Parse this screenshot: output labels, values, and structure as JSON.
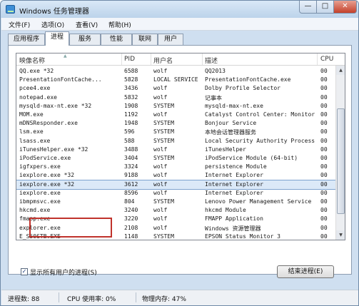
{
  "window": {
    "title": "Windows 任务管理器",
    "controls": {
      "minimize": "—",
      "maximize": "□",
      "close": "✕"
    }
  },
  "menu": [
    "文件(F)",
    "选项(O)",
    "查看(V)",
    "帮助(H)"
  ],
  "tabs": [
    {
      "label": "应用程序",
      "active": false
    },
    {
      "label": "进程",
      "active": true
    },
    {
      "label": "服务",
      "active": false
    },
    {
      "label": "性能",
      "active": false
    },
    {
      "label": "联网",
      "active": false
    },
    {
      "label": "用户",
      "active": false
    }
  ],
  "columns": {
    "name": "映像名称",
    "pid": "PID",
    "user": "用户名",
    "desc": "描述",
    "cpu": "CPU"
  },
  "processes": [
    {
      "name": "QQ.exe *32",
      "pid": "6588",
      "user": "wolf",
      "desc": "QQ2013",
      "cpu": "00"
    },
    {
      "name": "PresentationFontCache...",
      "pid": "5828",
      "user": "LOCAL SERVICE",
      "desc": "PresentationFontCache.exe",
      "cpu": "00"
    },
    {
      "name": "pcee4.exe",
      "pid": "3436",
      "user": "wolf",
      "desc": "Dolby Profile Selector",
      "cpu": "00"
    },
    {
      "name": "notepad.exe",
      "pid": "5832",
      "user": "wolf",
      "desc": "记事本",
      "cpu": "00"
    },
    {
      "name": "mysqld-max-nt.exe *32",
      "pid": "1908",
      "user": "SYSTEM",
      "desc": "mysqld-max-nt.exe",
      "cpu": "00"
    },
    {
      "name": "MOM.exe",
      "pid": "1192",
      "user": "wolf",
      "desc": "Catalyst Control Center: Monitor...",
      "cpu": "00"
    },
    {
      "name": "mDNSResponder.exe",
      "pid": "1948",
      "user": "SYSTEM",
      "desc": "Bonjour Service",
      "cpu": "00"
    },
    {
      "name": "lsm.exe",
      "pid": "596",
      "user": "SYSTEM",
      "desc": "本地会话管理器服务",
      "cpu": "00"
    },
    {
      "name": "lsass.exe",
      "pid": "588",
      "user": "SYSTEM",
      "desc": "Local Security Authority Process",
      "cpu": "00"
    },
    {
      "name": "iTunesHelper.exe *32",
      "pid": "3488",
      "user": "wolf",
      "desc": "iTunesHelper",
      "cpu": "00"
    },
    {
      "name": "iPodService.exe",
      "pid": "3404",
      "user": "SYSTEM",
      "desc": "iPodService Module (64-bit)",
      "cpu": "00"
    },
    {
      "name": "igfxpers.exe",
      "pid": "3324",
      "user": "wolf",
      "desc": "persistence Module",
      "cpu": "00"
    },
    {
      "name": "iexplore.exe *32",
      "pid": "9188",
      "user": "wolf",
      "desc": "Internet Explorer",
      "cpu": "00"
    },
    {
      "name": "iexplore.exe *32",
      "pid": "3612",
      "user": "wolf",
      "desc": "Internet Explorer",
      "cpu": "00",
      "selected": true
    },
    {
      "name": "iexplore.exe",
      "pid": "8596",
      "user": "wolf",
      "desc": "Internet Explorer",
      "cpu": "00"
    },
    {
      "name": "ibmpmsvc.exe",
      "pid": "804",
      "user": "SYSTEM",
      "desc": "Lenovo Power Management Service",
      "cpu": "00"
    },
    {
      "name": "hkcmd.exe",
      "pid": "3240",
      "user": "wolf",
      "desc": "hkcmd Module",
      "cpu": "00"
    },
    {
      "name": "fmapp.exe",
      "pid": "3220",
      "user": "wolf",
      "desc": "FMAPP Application",
      "cpu": "00"
    },
    {
      "name": "explorer.exe",
      "pid": "2108",
      "user": "wolf",
      "desc": "Windows 资源管理器",
      "cpu": "00"
    },
    {
      "name": "E_S50STB.EXE",
      "pid": "1148",
      "user": "SYSTEM",
      "desc": "EPSON Status Monitor 3",
      "cpu": "00"
    },
    {
      "name": "E_S50RPB.EXE",
      "pid": "1676",
      "user": "SYSTEM",
      "desc": "EPSON Status Monitor 3",
      "cpu": "00"
    }
  ],
  "show_all_users": {
    "label": "显示所有用户的进程(S)",
    "checked": true,
    "mark": "✓"
  },
  "end_process_button": "结束进程(E)",
  "status": {
    "process_count": "进程数: 88",
    "cpu_usage": "CPU 使用率: 0%",
    "memory": "物理内存: 47%"
  },
  "colors": {
    "selection": "#dbe9f8",
    "highlight_box": "#c0322b",
    "titlebar": "#bcd3ea"
  }
}
